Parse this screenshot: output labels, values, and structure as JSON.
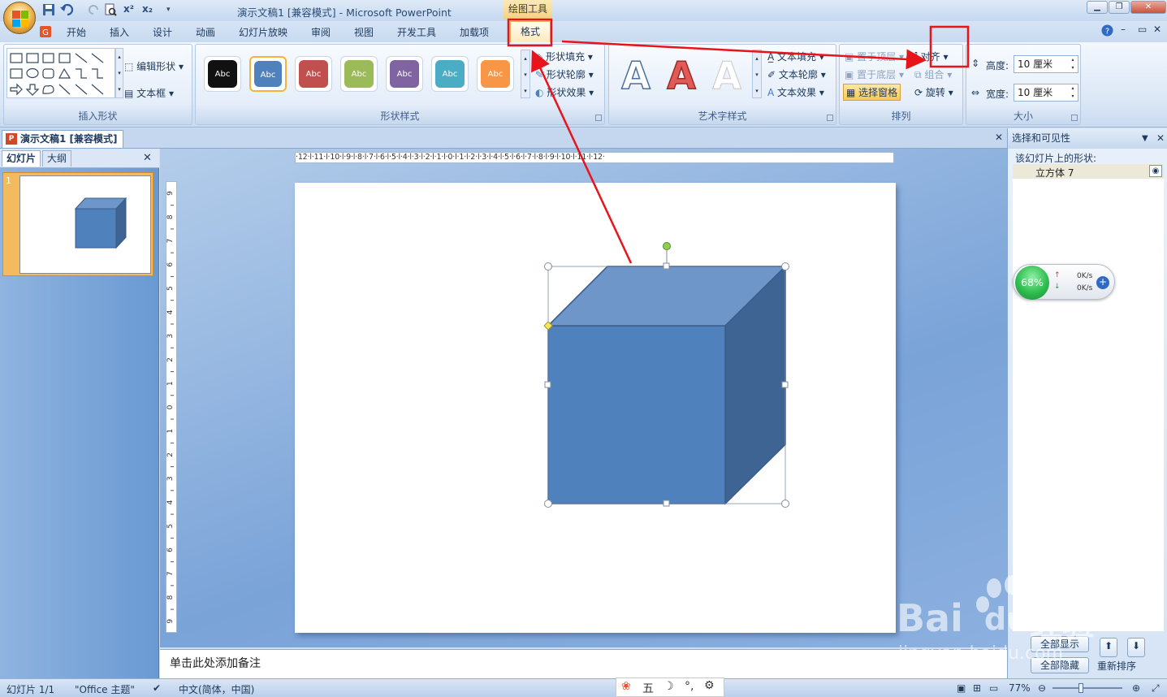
{
  "window": {
    "title": "演示文稿1 [兼容模式] - Microsoft PowerPoint",
    "context_tab_title": "绘图工具",
    "quick_access": [
      "x²",
      "x₂"
    ]
  },
  "tabs": [
    "开始",
    "插入",
    "设计",
    "动画",
    "幻灯片放映",
    "审阅",
    "视图",
    "开发工具",
    "加载项"
  ],
  "active_tab": "格式",
  "ribbon": {
    "insert_shapes": {
      "label": "插入形状",
      "edit_shape": "编辑形状",
      "text_box": "文本框"
    },
    "shape_styles": {
      "label": "形状样式",
      "swatches": [
        {
          "text": "Abc",
          "color": "#111111"
        },
        {
          "text": "Abc",
          "color": "#4f81bd"
        },
        {
          "text": "Abc",
          "color": "#c0504d"
        },
        {
          "text": "Abc",
          "color": "#9bbb59"
        },
        {
          "text": "Abc",
          "color": "#8064a2"
        },
        {
          "text": "Abc",
          "color": "#4bacc6"
        },
        {
          "text": "Abc",
          "color": "#f79646"
        }
      ],
      "fill": "形状填充",
      "outline": "形状轮廓",
      "effects": "形状效果"
    },
    "wordart": {
      "label": "艺术字样式",
      "glyph": "A",
      "text_fill": "文本填充",
      "text_outline": "文本轮廓",
      "text_effects": "文本效果"
    },
    "arrange": {
      "label": "排列",
      "bring_front": "置于顶层",
      "send_back": "置于底层",
      "selection_pane": "选择窗格",
      "align": "对齐",
      "group": "组合",
      "rotate": "旋转"
    },
    "size": {
      "label": "大小",
      "height_label": "高度:",
      "height_value": "10 厘米",
      "width_label": "宽度:",
      "width_value": "10 厘米"
    }
  },
  "document_tab": "演示文稿1 [兼容模式]",
  "left_panel": {
    "tab_slides": "幻灯片",
    "tab_outline": "大纲",
    "slide_number": "1"
  },
  "rulers": {
    "horizontal": "·12·l·11·l·10·l·9·l·8·l·7·l·6·l·5·l·4·l·3·l·2·l·1·l·0·l·1·l·2·l·3·l·4·l·5·l·6·l·7·l·8·l·9·l·10·l·11·l·12·",
    "vertical_labels": [
      "9",
      "8",
      "7",
      "6",
      "5",
      "4",
      "3",
      "2",
      "1",
      "0",
      "1",
      "2",
      "3",
      "4",
      "5",
      "6",
      "7",
      "8",
      "9"
    ]
  },
  "slide": {
    "shape_fill": "#4f81bd",
    "shape_top": "#6f96c8",
    "shape_side": "#3e6494",
    "shape_outline": "#385d8a"
  },
  "notes_placeholder": "单击此处添加备注",
  "selection_pane": {
    "title": "选择和可见性",
    "subtitle": "该幻灯片上的形状:",
    "shapes": [
      "立方体 7"
    ],
    "show_all": "全部显示",
    "hide_all": "全部隐藏",
    "reorder": "重新排序"
  },
  "net_widget": {
    "percent": "68%",
    "up": "0K/s",
    "down": "0K/s"
  },
  "status_bar": {
    "slide": "幻灯片 1/1",
    "theme": "\"Office 主题\"",
    "language": "中文(简体，中国)",
    "zoom": "77%"
  },
  "ime_bar": [
    "五"
  ],
  "watermark": {
    "brand": "Bai",
    "brand2": "du",
    "cn": "经验",
    "url": "jingyan.baidu.com"
  },
  "annotation_color": "#e8141b"
}
